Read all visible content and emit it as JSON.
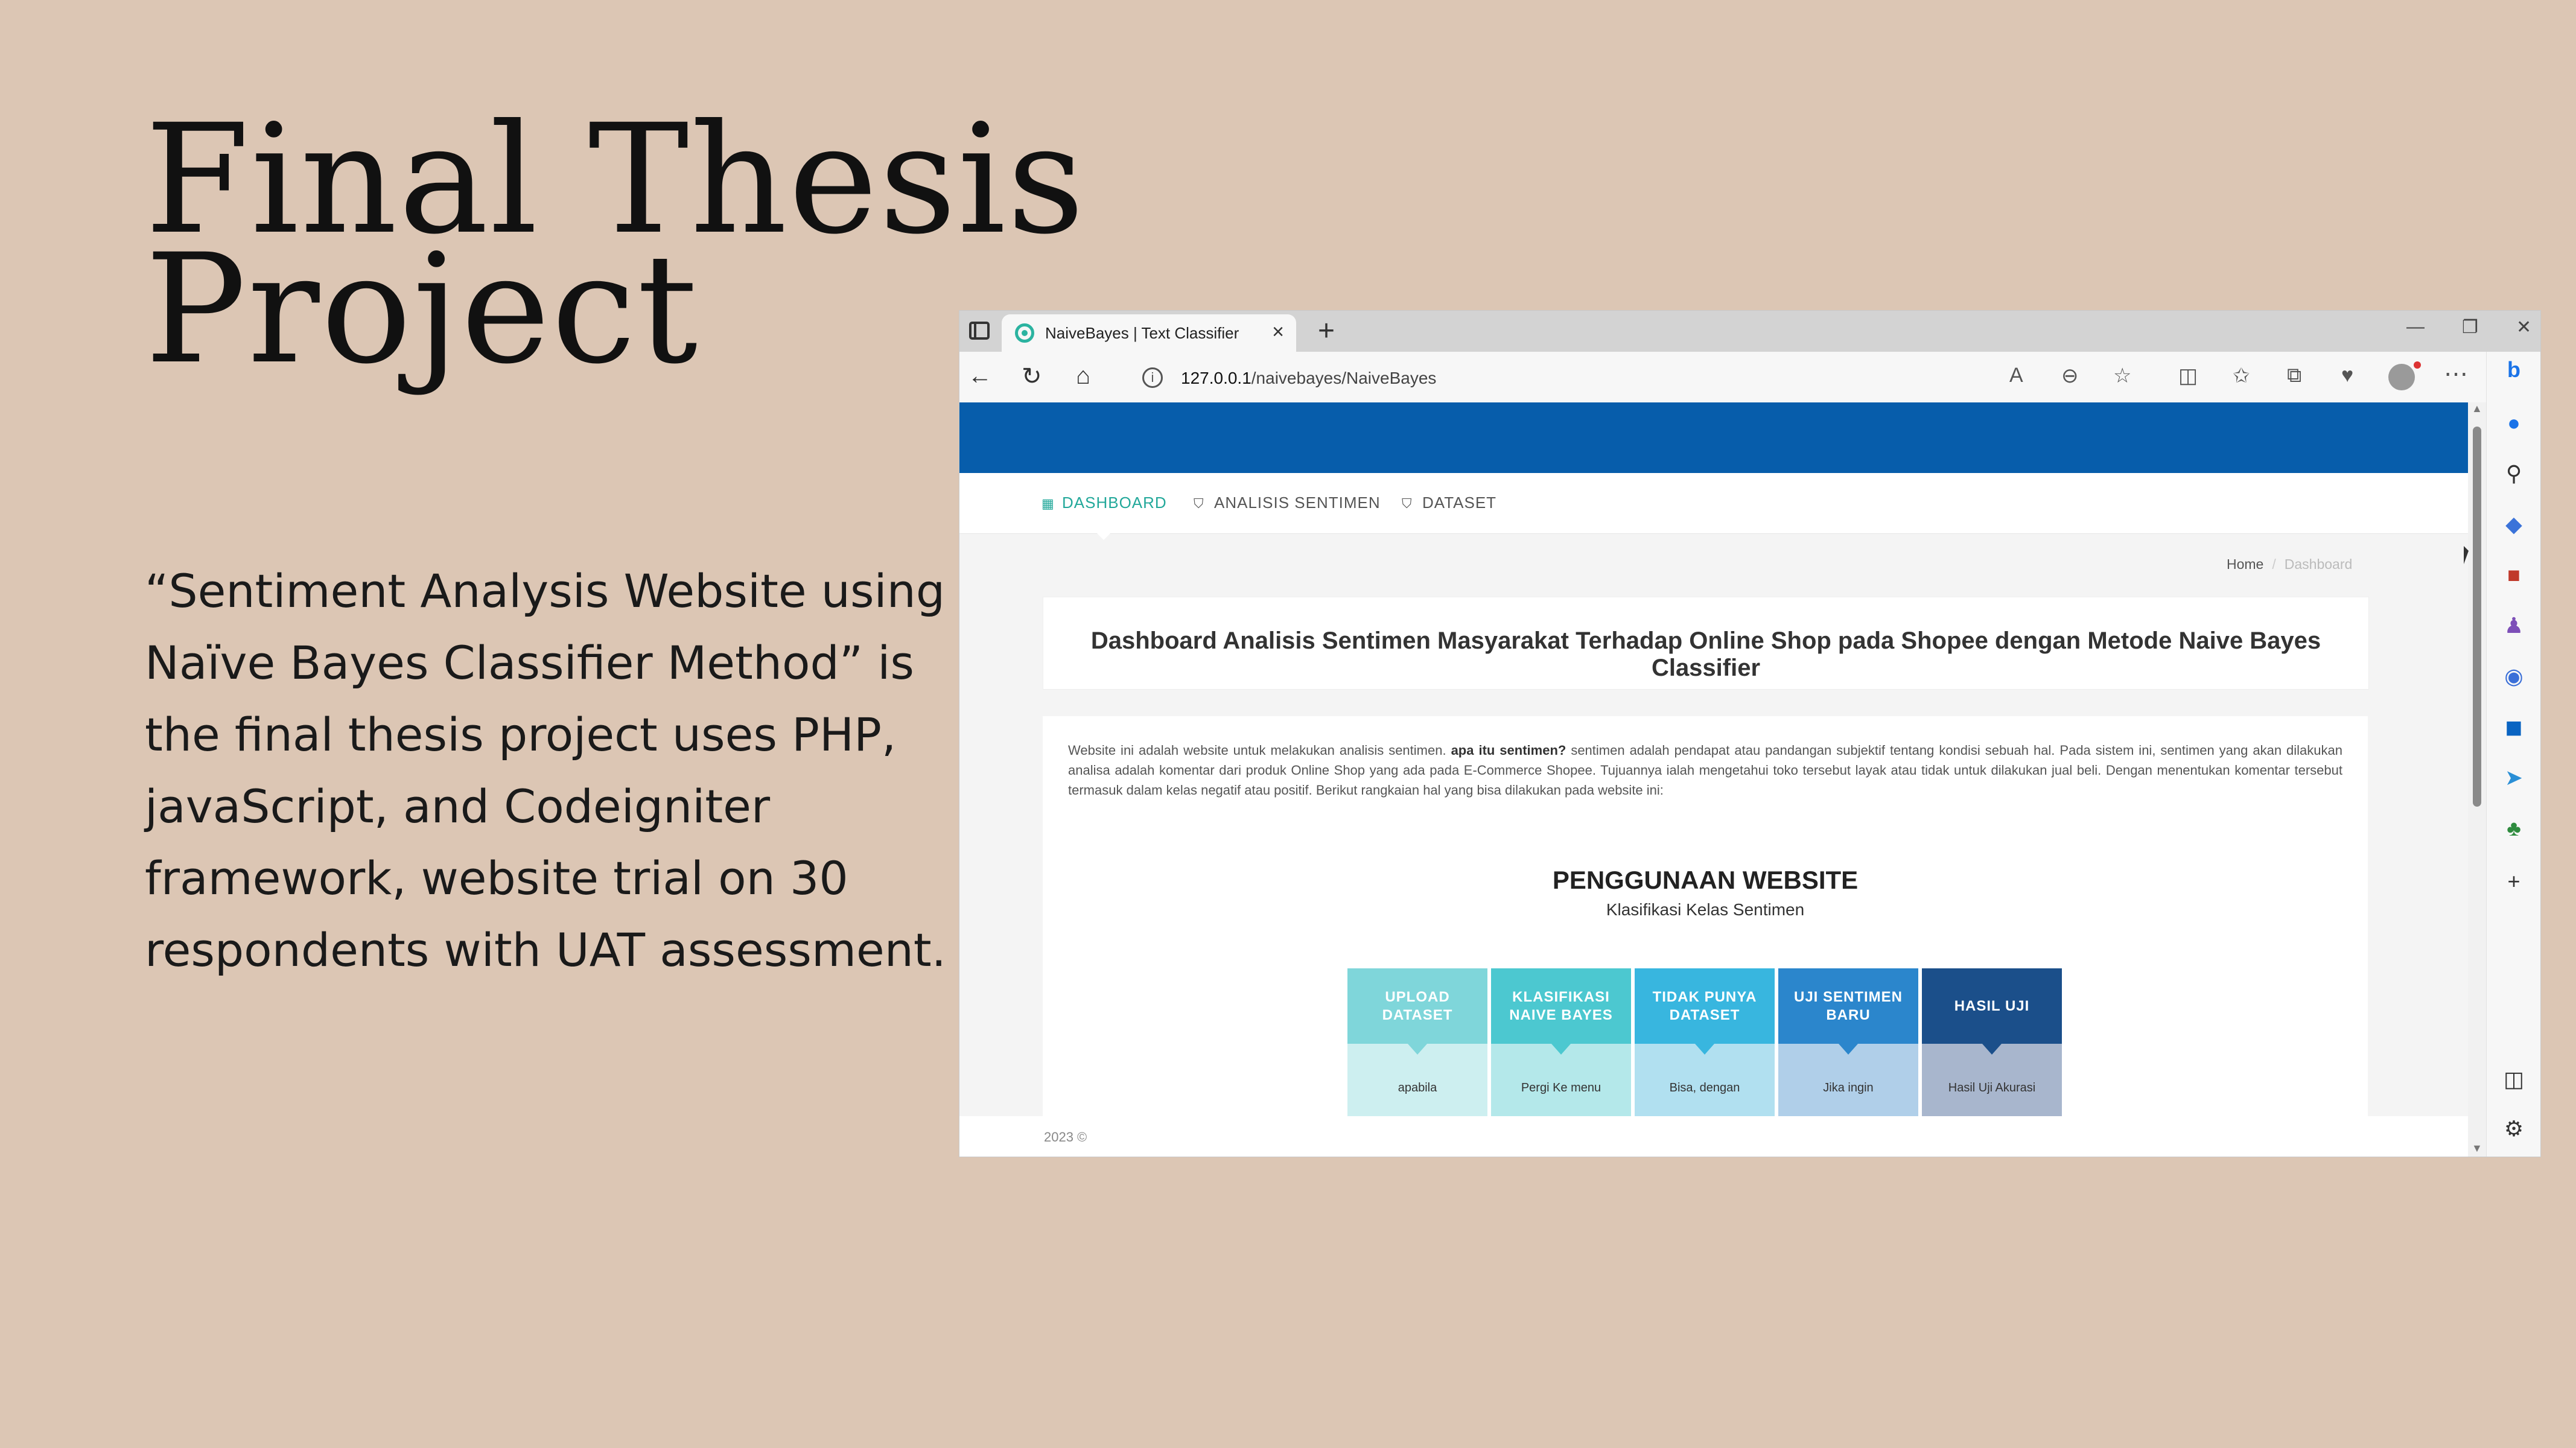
{
  "slide": {
    "title": "Final Thesis\nProject",
    "description": "“Sentiment Analysis Website using Naïve Bayes Classifier Method” is the final thesis project uses PHP, javaScript, and Codeigniter framework, website trial on 30 respondents with UAT assessment."
  },
  "browser": {
    "tab_title": "NaiveBayes | Text Classifier",
    "url_host": "127.0.0.1",
    "url_path": "/naivebayes/NaiveBayes"
  },
  "site": {
    "nav": [
      {
        "label": "DASHBOARD",
        "icon": "dashboard-icon",
        "active": true
      },
      {
        "label": "ANALISIS SENTIMEN",
        "icon": "shield-icon",
        "active": false
      },
      {
        "label": "DATASET",
        "icon": "shield-icon",
        "active": false
      }
    ],
    "breadcrumb": {
      "home": "Home",
      "current": "Dashboard"
    },
    "heading": "Dashboard Analisis Sentimen Masyarakat Terhadap Online Shop pada Shopee dengan Metode Naive Bayes Classifier",
    "intro_1": "Website ini adalah website untuk melakukan analisis sentimen. ",
    "intro_bold": "apa itu sentimen?",
    "intro_2": " sentimen adalah pendapat atau pandangan subjektif tentang kondisi sebuah hal. Pada sistem ini, sentimen yang akan dilakukan analisa adalah komentar dari produk Online Shop yang ada pada E-Commerce Shopee. Tujuannya ialah mengetahui toko tersebut layak atau tidak untuk dilakukan jual beli. Dengan menentukan komentar tersebut termasuk dalam kelas negatif atau positif. Berikut rangkaian hal yang bisa dilakukan pada website ini:",
    "usage_title": "PENGGUNAAN WEBSITE",
    "usage_subtitle": "Klasifikasi Kelas Sentimen",
    "steps": [
      {
        "title": "UPLOAD DATASET",
        "body": "apabila",
        "color": "#7fd6da",
        "body_color": "#cdeff0"
      },
      {
        "title": "KLASIFIKASI NAIVE BAYES",
        "body": "Pergi Ke menu",
        "color": "#4cc8d0",
        "body_color": "#b4e8ea"
      },
      {
        "title": "TIDAK PUNYA DATASET",
        "body": "Bisa, dengan",
        "color": "#38b6df",
        "body_color": "#b1e0f0"
      },
      {
        "title": "UJI SENTIMEN BARU",
        "body": "Jika ingin",
        "color": "#2b86cc",
        "body_color": "#b0cfe9"
      },
      {
        "title": "HASIL UJI",
        "body": "Hasil Uji Akurasi",
        "color": "#1b4f8a",
        "body_color": "#a8b6cd"
      }
    ],
    "footer": "2023 ©"
  }
}
